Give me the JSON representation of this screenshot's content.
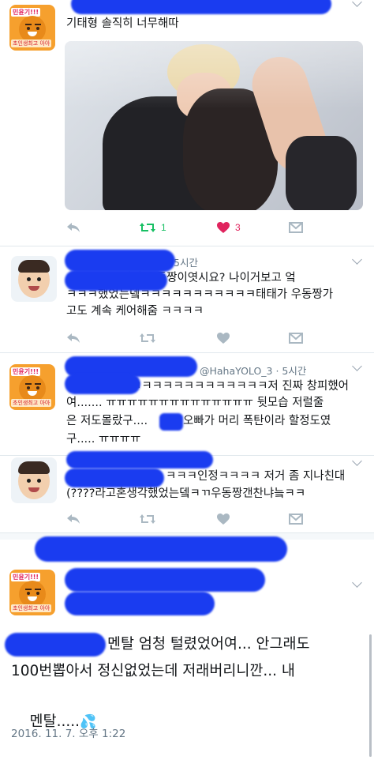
{
  "tweet1": {
    "text": "기태형 솔직히 너무해따",
    "actions": {
      "retweet_count": "1",
      "like_count": "3"
    }
  },
  "ryan_avatar": {
    "badge": "민윤기!!!",
    "tag": "초인생최고",
    "tag2": "아아"
  },
  "reply1": {
    "time": "5시간",
    "text": "               이거 우동짱이엿시요? 나이거보고 엌\nㅋㅋㅋ했었는뎈ㅋㅋㅋㅋㅋㅋㅋㅋㅋㅋㅋ태태가 우동짱가\n고도 계속 케어해줌 ㅋㅋㅋㅋ"
  },
  "reply2": {
    "handle": "@HahaYOLO_3",
    "time": "5시간",
    "line1": "ㅋㅋㅋㅋㅋㅋㅋㅋㅋㅋㅋㅋㅋ저 진짜 창피했어",
    "line2": "여....... ㅠㅠㅠㅠㅠㅠㅠㅠㅠㅠㅠㅠㅠㅠ 뒷모습 저럴줄",
    "line3": "은 저도몰랐구....",
    "line3b": "오빠가 머리 폭탄이라 할정도였",
    "line4": "구..... ㅠㅠㅠㅠ"
  },
  "reply3": {
    "line1": "ㅋㅋㅋ인정ㅋㅋㅋㅋ 저거 좀 지나친대",
    "line2": "(????라고혼생각했었는뎈ㅋㄲ우동짱갠찬냐늨ㅋㅋ"
  },
  "main_tweet": {
    "line1": "멘탈 엄청 털렸었어여... 안그래도",
    "line2": "100번뽑아서 정신없었는데 저래버리니깐... 내",
    "line3": "멘탈.....",
    "emoji": "💦",
    "timestamp": "2016. 11. 7. 오후 1:22"
  },
  "colors": {
    "retweet_green": "#17bf63",
    "like_red": "#e0245e",
    "icon_gray": "#aab8c2",
    "redaction_blue": "#1a3cf0"
  },
  "icons": [
    "reply-icon",
    "retweet-icon",
    "heart-icon",
    "message-icon",
    "chevron-down-icon"
  ]
}
